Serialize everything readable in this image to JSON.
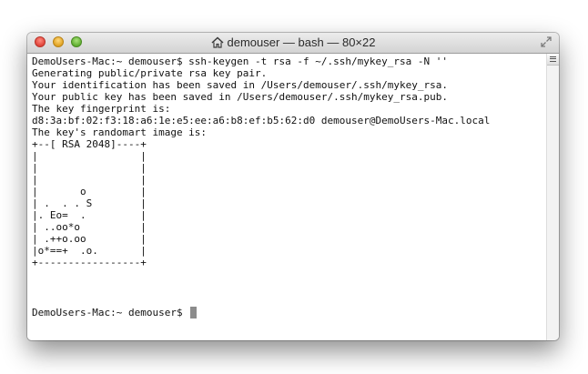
{
  "window": {
    "title": "demouser — bash — 80×22"
  },
  "terminal": {
    "lines": [
      "DemoUsers-Mac:~ demouser$ ssh-keygen -t rsa -f ~/.ssh/mykey_rsa -N ''",
      "Generating public/private rsa key pair.",
      "Your identification has been saved in /Users/demouser/.ssh/mykey_rsa.",
      "Your public key has been saved in /Users/demouser/.ssh/mykey_rsa.pub.",
      "The key fingerprint is:",
      "d8:3a:bf:02:f3:18:a6:1e:e5:ee:a6:b8:ef:b5:62:d0 demouser@DemoUsers-Mac.local",
      "The key's randomart image is:",
      "+--[ RSA 2048]----+",
      "|                 |",
      "|                 |",
      "|                 |",
      "|       o         |",
      "| .  . . S        |",
      "|. Eo=  .         |",
      "| ..oo*o          |",
      "| .++o.oo         |",
      "|o*==+  .o.       |",
      "+-----------------+"
    ],
    "prompt": "DemoUsers-Mac:~ demouser$ "
  },
  "icons": {
    "title": "home-icon",
    "fullscreen": "fullscreen-icon",
    "scroll": "scroll-menu-icon"
  },
  "colors": {
    "close": "#e0443a",
    "minimize": "#e0a223",
    "zoom": "#5fae30",
    "cursor": "#8c8c8c"
  }
}
